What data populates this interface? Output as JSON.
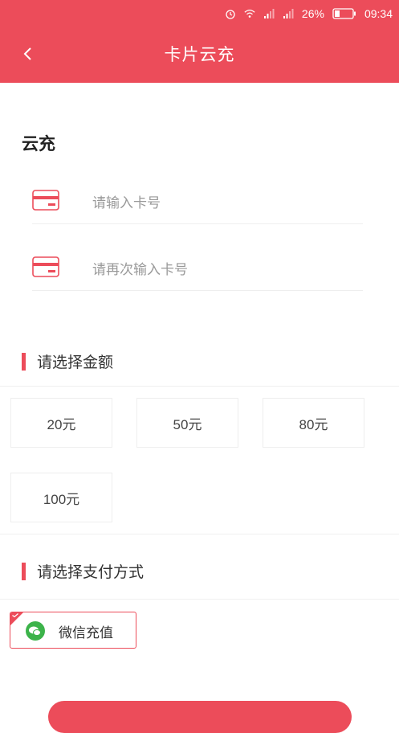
{
  "status_bar": {
    "battery": "26%",
    "time": "09:34"
  },
  "header": {
    "title": "卡片云充"
  },
  "section": {
    "title": "云充"
  },
  "fields": {
    "card_number_placeholder": "请输入卡号",
    "card_number_confirm_placeholder": "请再次输入卡号"
  },
  "amount": {
    "heading": "请选择金额",
    "options": [
      "20元",
      "50元",
      "80元",
      "100元"
    ]
  },
  "payment": {
    "heading": "请选择支付方式",
    "method_label": "微信充值"
  },
  "colors": {
    "accent": "#ec4c5a",
    "wechat": "#3cb34a"
  }
}
